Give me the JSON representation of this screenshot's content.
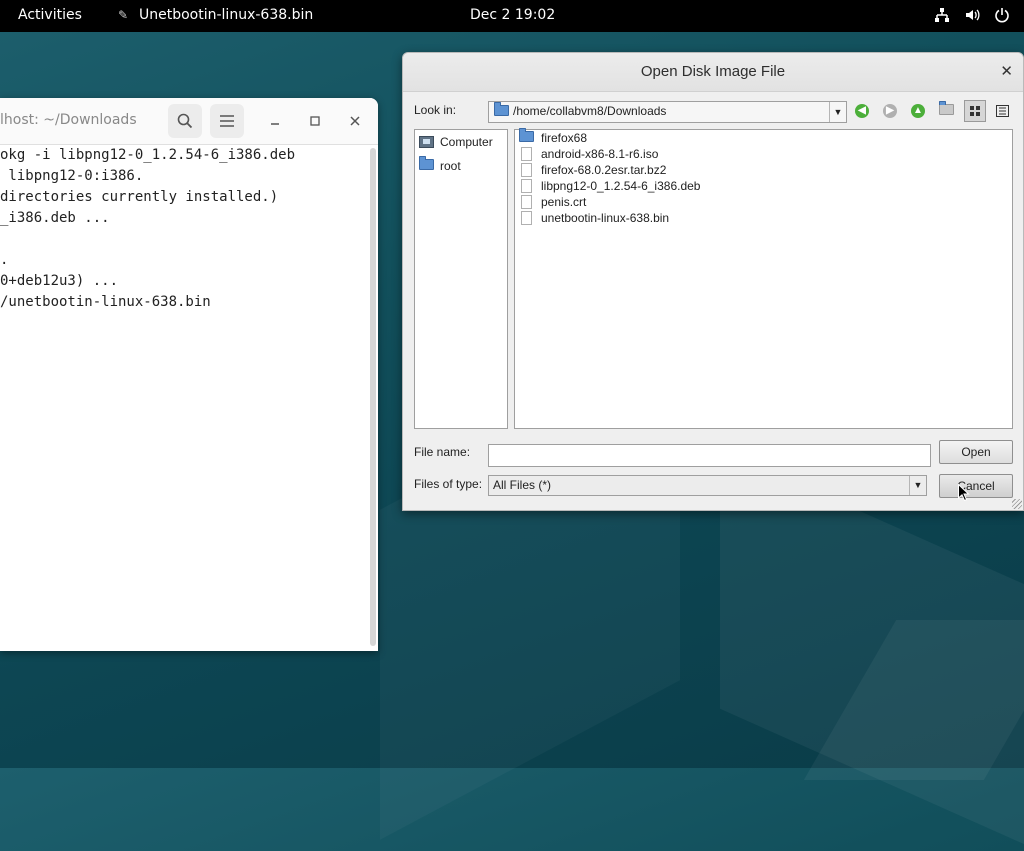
{
  "topbar": {
    "activities": "Activities",
    "app_name": "Unetbootin-linux-638.bin",
    "clock": "Dec 2  19:02",
    "tray_icons": [
      "network-icon",
      "volume-icon",
      "power-icon"
    ]
  },
  "terminal": {
    "title": "lhost: ~/Downloads",
    "lines": [
      "okg -i libpng12-0_1.2.54-6_i386.deb",
      " libpng12-0:i386.",
      "directories currently installed.)",
      "_i386.deb ...",
      "",
      ".",
      "0+deb12u3) ...",
      "/unetbootin-linux-638.bin"
    ]
  },
  "dialog": {
    "title": "Open Disk Image File",
    "look_in_label": "Look in:",
    "look_in_value": "/home/collabvm8/Downloads",
    "sidebar": [
      {
        "label": "Computer",
        "icon": "computer-icon"
      },
      {
        "label": "root",
        "icon": "folder-icon"
      }
    ],
    "files": [
      {
        "name": "firefox68",
        "type": "folder"
      },
      {
        "name": "android-x86-8.1-r6.iso",
        "type": "file"
      },
      {
        "name": "firefox-68.0.2esr.tar.bz2",
        "type": "file"
      },
      {
        "name": "libpng12-0_1.2.54-6_i386.deb",
        "type": "file"
      },
      {
        "name": "penis.crt",
        "type": "file"
      },
      {
        "name": "unetbootin-linux-638.bin",
        "type": "file"
      }
    ],
    "file_name_label": "File name:",
    "file_name_value": "",
    "files_of_type_label": "Files of type:",
    "files_of_type_value": "All Files (*)",
    "open_button": "Open",
    "cancel_button": "Cancel"
  },
  "colors": {
    "desktop": "#12505c",
    "topbar": "#000000",
    "folder": "#5d93d3",
    "nav_green": "#4caf3a",
    "nav_gray": "#b0b0b0"
  }
}
